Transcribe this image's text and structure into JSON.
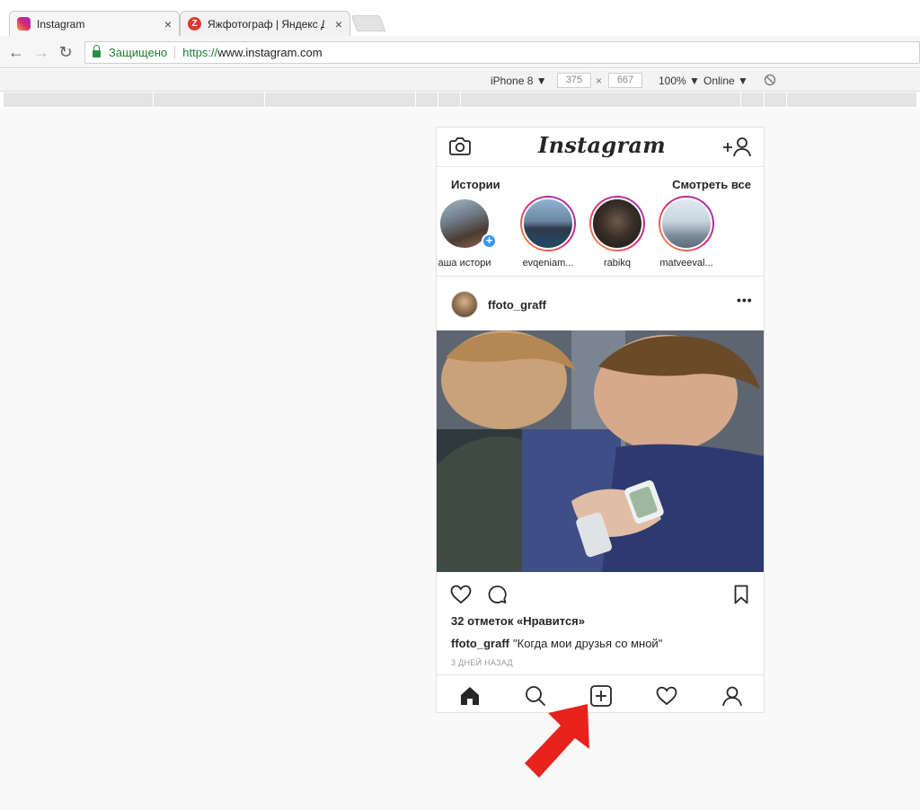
{
  "browser": {
    "tabs": [
      {
        "title": "Instagram",
        "close": "×"
      },
      {
        "title": "Яжфотограф | Яндекс Д",
        "close": "×"
      }
    ],
    "address": {
      "security_label": "Защищено",
      "scheme": "https://",
      "host": "www.instagram.com"
    },
    "device_toolbar": {
      "device": "iPhone 8 ▼",
      "width": "375",
      "times": "×",
      "height": "667",
      "zoom": "100% ▼",
      "network": "Online ▼"
    }
  },
  "instagram": {
    "logo": "Instagram",
    "stories": {
      "heading": "Истории",
      "see_all": "Смотреть все",
      "items": [
        {
          "name": "аша истори",
          "own": true
        },
        {
          "name": "evqeniam..."
        },
        {
          "name": "rabikq"
        },
        {
          "name": "matveeval..."
        }
      ]
    },
    "post": {
      "username": "ffoto_graff",
      "more": "•••",
      "likes": "32 отметок «Нравится»",
      "caption_user": "ffoto_graff",
      "caption_text": "\"Когда мои друзья со мной\"",
      "time_ago": "3 ДНЕЙ НАЗАД"
    },
    "icons": {
      "header_left": "camera-icon",
      "header_right": "add-person-icon",
      "nav": [
        "home-icon",
        "search-icon",
        "new-post-icon",
        "activity-heart-icon",
        "profile-icon"
      ]
    }
  },
  "colors": {
    "annotation_arrow": "#e8231d",
    "story_ring_start": "#f7a136",
    "story_ring_end": "#962fbf",
    "secure_green": "#1e7e34"
  }
}
